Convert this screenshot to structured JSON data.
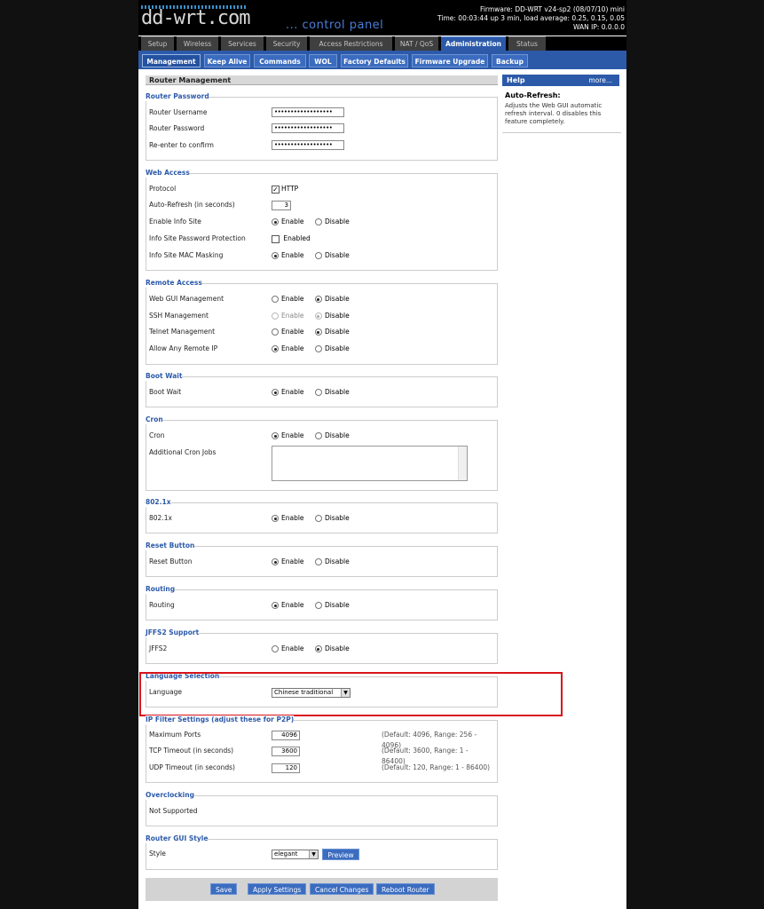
{
  "header": {
    "logo": "dd-wrt.com",
    "subtitle": "... control panel",
    "firmware": "Firmware: DD-WRT v24-sp2 (08/07/10) mini",
    "time": "Time: 00:03:44 up 3 min, load average: 0.25, 0.15, 0.05",
    "wan_ip": "WAN IP: 0.0.0.0"
  },
  "main_tabs": [
    "Setup",
    "Wireless",
    "Services",
    "Security",
    "Access Restrictions",
    "NAT / QoS",
    "Administration",
    "Status"
  ],
  "sub_tabs": [
    "Management",
    "Keep Alive",
    "Commands",
    "WOL",
    "Factory Defaults",
    "Firmware Upgrade",
    "Backup"
  ],
  "page_title": "Router Management",
  "opts": {
    "enable": "Enable",
    "disable": "Disable",
    "enabled": "Enabled"
  },
  "router_password": {
    "legend": "Router Password",
    "username_label": "Router Username",
    "password_label": "Router Password",
    "confirm_label": "Re-enter to confirm",
    "mask": "••••••••••••••••••"
  },
  "web_access": {
    "legend": "Web Access",
    "protocol_label": "Protocol",
    "protocol_value": "HTTP",
    "autorefresh_label": "Auto-Refresh (in seconds)",
    "autorefresh_value": "3",
    "infosite_label": "Enable Info Site",
    "infopw_label": "Info Site Password Protection",
    "infomac_label": "Info Site MAC Masking"
  },
  "remote_access": {
    "legend": "Remote Access",
    "webgui_label": "Web GUI Management",
    "ssh_label": "SSH Management",
    "telnet_label": "Telnet Management",
    "anyip_label": "Allow Any Remote IP"
  },
  "boot_wait": {
    "legend": "Boot Wait",
    "label": "Boot Wait"
  },
  "cron": {
    "legend": "Cron",
    "label": "Cron",
    "jobs_label": "Additional Cron Jobs"
  },
  "dot1x": {
    "legend": "802.1x",
    "label": "802.1x"
  },
  "reset_button": {
    "legend": "Reset Button",
    "label": "Reset Button"
  },
  "routing": {
    "legend": "Routing",
    "label": "Routing"
  },
  "jffs2": {
    "legend": "JFFS2 Support",
    "label": "JFFS2"
  },
  "language": {
    "legend": "Language Selection",
    "label": "Language",
    "value": "Chinese traditional"
  },
  "ip_filter": {
    "legend": "IP Filter Settings (adjust these for P2P)",
    "maxports_label": "Maximum Ports",
    "maxports_value": "4096",
    "maxports_hint": "(Default: 4096, Range: 256 - 4096)",
    "tcp_label": "TCP Timeout (in seconds)",
    "tcp_value": "3600",
    "tcp_hint": "(Default: 3600, Range: 1 - 86400)",
    "udp_label": "UDP Timeout (in seconds)",
    "udp_value": "120",
    "udp_hint": "(Default: 120, Range: 1 - 86400)"
  },
  "overclocking": {
    "legend": "Overclocking",
    "text": "Not Supported"
  },
  "gui_style": {
    "legend": "Router GUI Style",
    "label": "Style",
    "value": "elegant",
    "preview": "Preview"
  },
  "buttons": {
    "save": "Save",
    "apply": "Apply Settings",
    "cancel": "Cancel Changes",
    "reboot": "Reboot Router"
  },
  "help": {
    "title": "Help",
    "more": "more...",
    "topic": "Auto-Refresh:",
    "text": "Adjusts the Web GUI automatic refresh interval. 0 disables this feature completely."
  }
}
